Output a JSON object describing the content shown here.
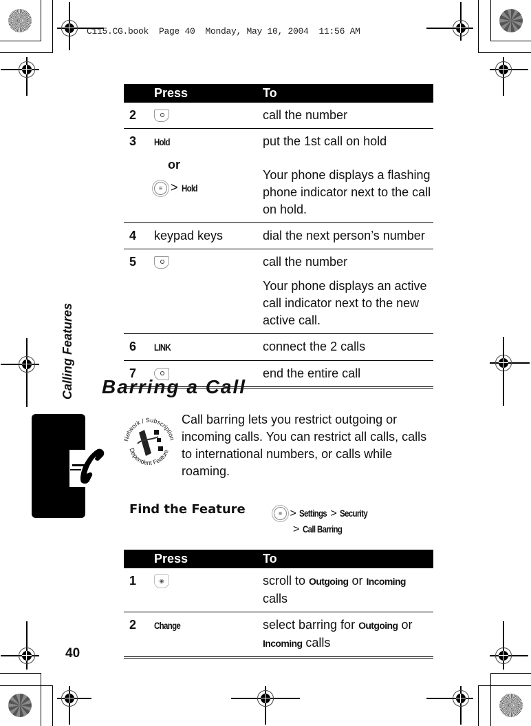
{
  "print_header": "C115.CG.book  Page 40  Monday, May 10, 2004  11:56 AM",
  "side_label": "Calling Features",
  "page_number": "40",
  "table1": {
    "headers": {
      "press": "Press",
      "to": "To"
    },
    "rows": [
      {
        "num": "2",
        "press_icon": "send-key-icon",
        "to": "call the number"
      },
      {
        "num": "3",
        "press_key": "Hold",
        "or": "or",
        "press_icon2": "menu-key-icon",
        "press_sep": ">",
        "press_key2": "Hold",
        "to": "put the 1st call on hold",
        "note": "Your phone displays a flashing phone indicator next to the call on hold."
      },
      {
        "num": "4",
        "press_text": "keypad keys",
        "to": "dial the next person’s number"
      },
      {
        "num": "5",
        "press_icon": "send-key-icon",
        "to": "call the number",
        "note": "Your phone displays an active call indicator next to the new active call."
      },
      {
        "num": "6",
        "press_key": "LINK",
        "to": "connect the 2 calls"
      },
      {
        "num": "7",
        "press_icon": "end-key-icon",
        "to": "end the entire call"
      }
    ]
  },
  "section": {
    "title": "Barring a Call",
    "badge_top": "Network / Subscription",
    "badge_bottom": "Dependent Feature",
    "intro": "Call barring lets you restrict outgoing or incoming calls. You can restrict all calls, calls to international numbers, or calls while roaming."
  },
  "find_feature": {
    "label": "Find the Feature",
    "path": [
      "Settings",
      "Security",
      "Call Barring"
    ],
    "sep": ">"
  },
  "table2": {
    "headers": {
      "press": "Press",
      "to": "To"
    },
    "rows": [
      {
        "num": "1",
        "press_icon": "nav-key-icon",
        "to_pre": "scroll to ",
        "to_k1": "Outgoing",
        "to_mid": " or ",
        "to_k2": "Incoming",
        "to_post": " calls"
      },
      {
        "num": "2",
        "press_key": "Change",
        "to_pre": "select barring for ",
        "to_k1": "Outgoing",
        "to_mid": " or ",
        "to_k2": "Incoming",
        "to_post": " calls"
      }
    ]
  }
}
